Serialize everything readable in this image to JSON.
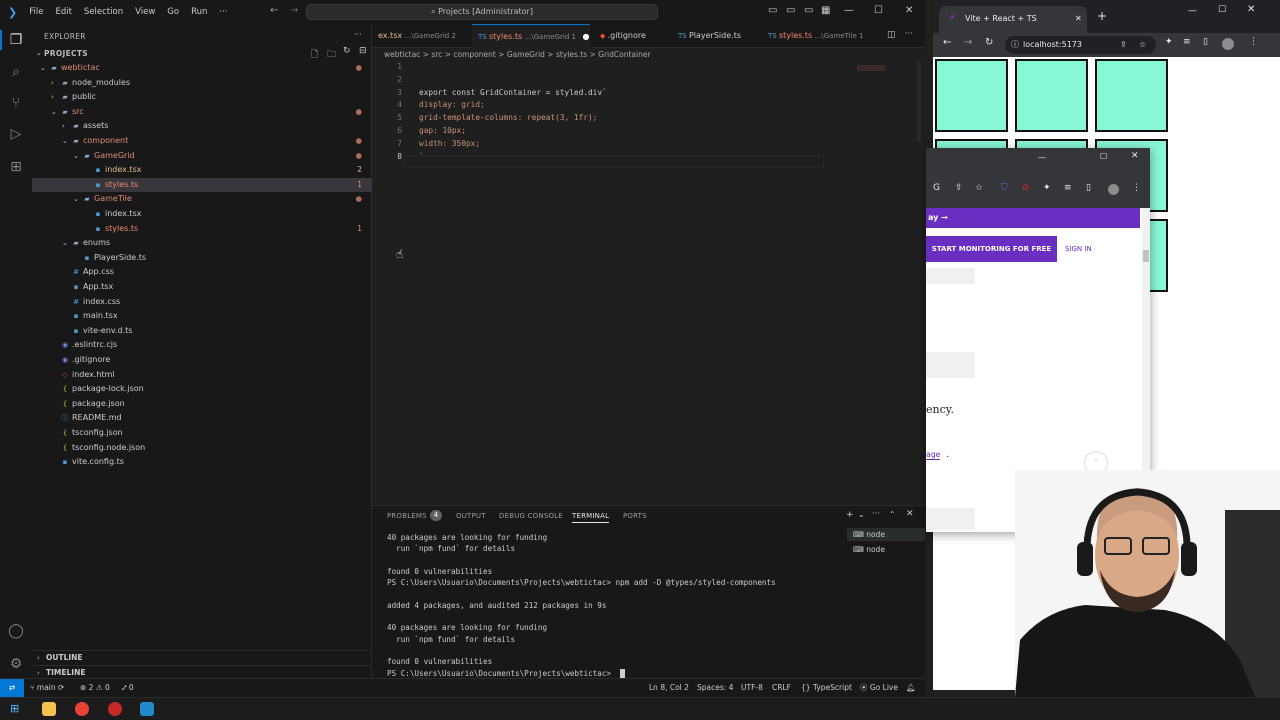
{
  "vscode": {
    "title_menu": [
      "File",
      "Edit",
      "Selection",
      "View",
      "Go",
      "Run",
      "···"
    ],
    "command_center": "Projects [Administrator]",
    "explorer_title": "EXPLORER",
    "projects_section": "PROJECTS",
    "tree": [
      {
        "label": "webtictac",
        "kind": "folder",
        "badge": "●"
      },
      {
        "label": "node_modules",
        "kind": "folder",
        "badge": ""
      },
      {
        "label": "public",
        "kind": "folder",
        "badge": ""
      },
      {
        "label": "src",
        "kind": "folder",
        "badge": "●"
      },
      {
        "label": "assets",
        "kind": "folder",
        "badge": ""
      },
      {
        "label": "component",
        "kind": "folder",
        "badge": "●"
      },
      {
        "label": "GameGrid",
        "kind": "folder",
        "badge": "●"
      },
      {
        "label": "index.tsx",
        "kind": "ts",
        "badge": "2"
      },
      {
        "label": "styles.ts",
        "kind": "ts",
        "badge": "1"
      },
      {
        "label": "GameTile",
        "kind": "folder",
        "badge": "●"
      },
      {
        "label": "index.tsx",
        "kind": "ts",
        "badge": ""
      },
      {
        "label": "styles.ts",
        "kind": "ts",
        "badge": "1"
      },
      {
        "label": "enums",
        "kind": "folder",
        "badge": ""
      },
      {
        "label": "PlayerSide.ts",
        "kind": "ts",
        "badge": ""
      },
      {
        "label": "App.css",
        "kind": "css",
        "badge": ""
      },
      {
        "label": "App.tsx",
        "kind": "ts",
        "badge": ""
      },
      {
        "label": "index.css",
        "kind": "css",
        "badge": ""
      },
      {
        "label": "main.tsx",
        "kind": "ts",
        "badge": ""
      },
      {
        "label": "vite-env.d.ts",
        "kind": "ts",
        "badge": ""
      },
      {
        "label": ".eslintrc.cjs",
        "kind": "config",
        "badge": ""
      },
      {
        "label": ".gitignore",
        "kind": "config",
        "badge": ""
      },
      {
        "label": "index.html",
        "kind": "html",
        "badge": ""
      },
      {
        "label": "package-lock.json",
        "kind": "json",
        "badge": ""
      },
      {
        "label": "package.json",
        "kind": "json",
        "badge": ""
      },
      {
        "label": "README.md",
        "kind": "md",
        "badge": ""
      },
      {
        "label": "tsconfig.json",
        "kind": "json",
        "badge": ""
      },
      {
        "label": "tsconfig.node.json",
        "kind": "json",
        "badge": ""
      },
      {
        "label": "vite.config.ts",
        "kind": "ts",
        "badge": ""
      }
    ],
    "outline_label": "OUTLINE",
    "timeline_label": "TIMELINE",
    "tabs": [
      {
        "label": "ex.tsx",
        "path": "...\\GameGrid 2"
      },
      {
        "label": "styles.ts",
        "path": "...\\GameGrid 1"
      },
      {
        "label": ".gitignore",
        "path": ""
      },
      {
        "label": "PlayerSide.ts",
        "path": ""
      },
      {
        "label": "styles.ts",
        "path": "...\\GameTile 1"
      }
    ],
    "breadcrumb": "webtictac > src > component > GameGrid > styles.ts > GridContainer",
    "code_lines": [
      {
        "n": "1",
        "text": ""
      },
      {
        "n": "2",
        "text": ""
      },
      {
        "n": "3",
        "text": "export const GridContainer = styled.div`"
      },
      {
        "n": "4",
        "text": "display: grid;"
      },
      {
        "n": "5",
        "text": "grid-template-columns: repeat(3, 1fr);"
      },
      {
        "n": "6",
        "text": "gap: 10px;"
      },
      {
        "n": "7",
        "text": "width: 350px;"
      },
      {
        "n": "8",
        "text": "`"
      }
    ],
    "panel_tabs": [
      "PROBLEMS",
      "OUTPUT",
      "DEBUG CONSOLE",
      "TERMINAL",
      "PORTS"
    ],
    "problems_count": "4",
    "terminal_lines": [
      "40 packages are looking for funding",
      "  run `npm fund` for details",
      "",
      "found 0 vulnerabilities",
      "PS C:\\Users\\Usuario\\Documents\\Projects\\webtictac> npm add -D @types/styled-components",
      "",
      "added 4 packages, and audited 212 packages in 9s",
      "",
      "40 packages are looking for funding",
      "  run `npm fund` for details",
      "",
      "found 0 vulnerabilities",
      "PS C:\\Users\\Usuario\\Documents\\Projects\\webtictac> "
    ],
    "terminal_sessions": [
      "node",
      "node"
    ],
    "status": {
      "branch": "main",
      "errors": "2",
      "warnings": "0",
      "ports": "0",
      "position": "Ln 8, Col 2",
      "spaces": "Spaces: 4",
      "encoding": "UTF-8",
      "eol": "CRLF",
      "language": "TypeScript",
      "golive": "Go Live"
    }
  },
  "browser": {
    "tab_title": "Vite + React + TS",
    "url": "localhost:5173",
    "tiles_visible": 9,
    "tile_color": "#88f7d6"
  },
  "overlay": {
    "banner": "ay →",
    "start_button": "START MONITORING FOR FREE",
    "sign_in": "SIGN IN",
    "text_fragment": "ency.",
    "link_fragment": "age",
    "link_suffix": "."
  },
  "colors": {
    "accent": "#0078d4",
    "purple": "#6a2fc2",
    "tile": "#88f7d6"
  }
}
